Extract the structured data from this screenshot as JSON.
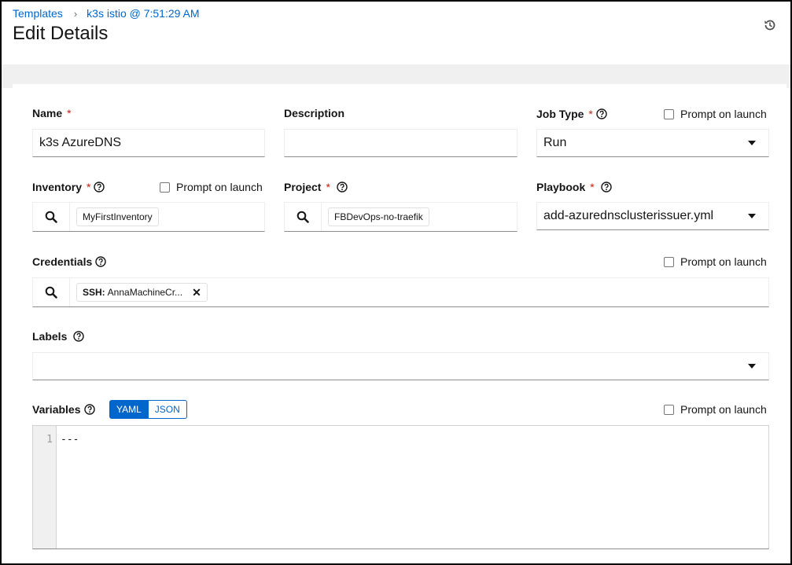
{
  "breadcrumb": {
    "items": [
      {
        "label": "Templates"
      },
      {
        "label": "k3s istio @ 7:51:29 AM"
      }
    ],
    "separator": "›"
  },
  "page_title": "Edit Details",
  "icons": {
    "history": "history-icon",
    "help": "question-circle-icon",
    "search": "search-icon",
    "caret": "caret-down-icon",
    "remove": "times-icon"
  },
  "form": {
    "name": {
      "label": "Name",
      "required_mark": "*",
      "value": "k3s AzureDNS"
    },
    "description": {
      "label": "Description",
      "value": ""
    },
    "job_type": {
      "label": "Job Type",
      "required_mark": "*",
      "value": "Run",
      "prompt_label": "Prompt on launch"
    },
    "inventory": {
      "label": "Inventory",
      "required_mark": "*",
      "chip": "MyFirstInventory",
      "prompt_label": "Prompt on launch"
    },
    "project": {
      "label": "Project",
      "required_mark": "*",
      "chip": "FBDevOps-no-traefik"
    },
    "playbook": {
      "label": "Playbook",
      "required_mark": "*",
      "value": "add-azurednsclusterissuer.yml"
    },
    "credentials": {
      "label": "Credentials",
      "chip_type": "SSH:",
      "chip_name": "AnnaMachineCr...",
      "prompt_label": "Prompt on launch"
    },
    "labels": {
      "label": "Labels",
      "value": ""
    },
    "variables": {
      "label": "Variables",
      "modes": [
        "YAML",
        "JSON"
      ],
      "selected_mode": "YAML",
      "prompt_label": "Prompt on launch",
      "line_numbers": [
        "1"
      ],
      "content": "---"
    }
  },
  "colors": {
    "link": "#0066cc",
    "required": "#c9190b",
    "toggle_active": "#0066cc",
    "page_bg": "#f0f0f0"
  }
}
